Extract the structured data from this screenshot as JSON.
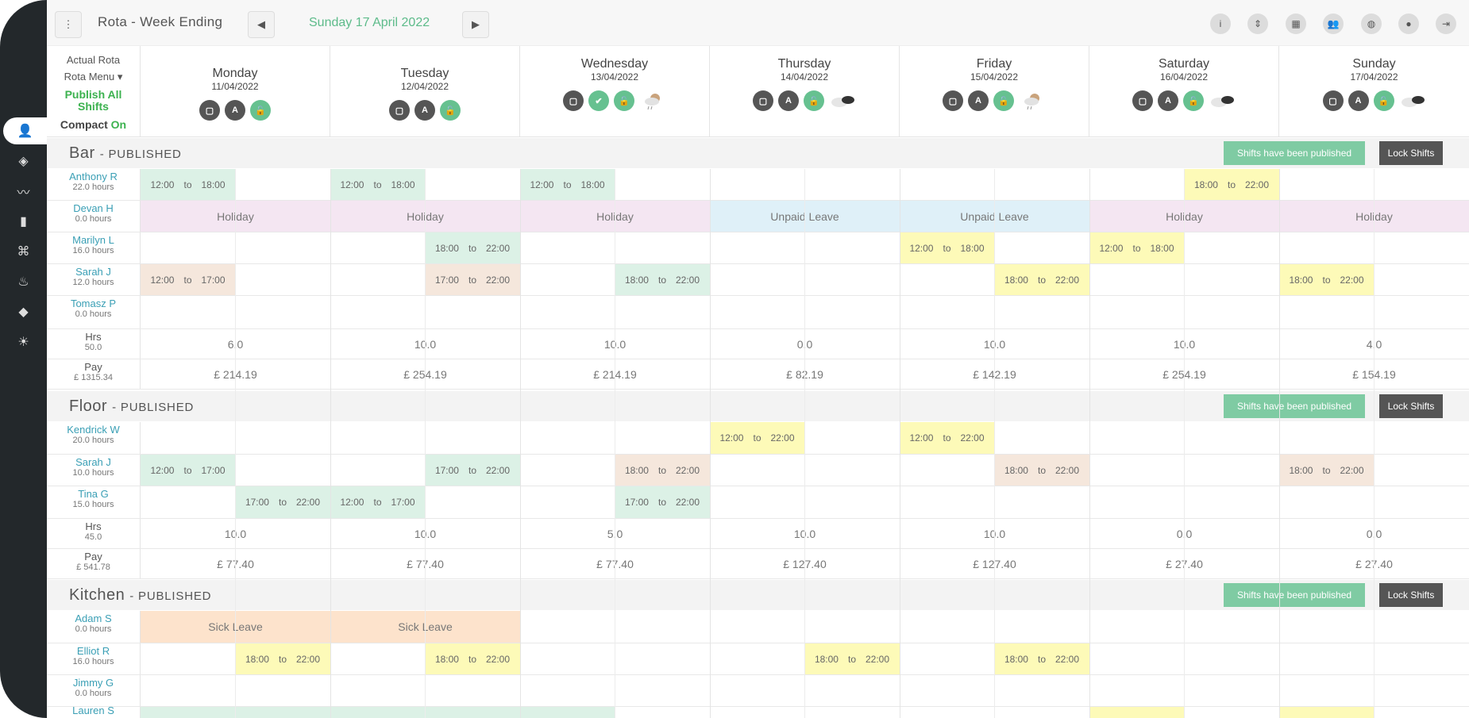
{
  "topbar": {
    "title": "Rota - Week Ending",
    "date": "Sunday 17 April 2022"
  },
  "left_header": {
    "actual_rota": "Actual Rota",
    "rota_menu": "Rota Menu ▾",
    "publish_all": "Publish All Shifts",
    "compact": "Compact",
    "compact_state": "On"
  },
  "days": [
    {
      "name": "Monday",
      "date": "11/04/2022"
    },
    {
      "name": "Tuesday",
      "date": "12/04/2022"
    },
    {
      "name": "Wednesday",
      "date": "13/04/2022"
    },
    {
      "name": "Thursday",
      "date": "14/04/2022"
    },
    {
      "name": "Friday",
      "date": "15/04/2022"
    },
    {
      "name": "Saturday",
      "date": "16/04/2022"
    },
    {
      "name": "Sunday",
      "date": "17/04/2022"
    }
  ],
  "shift_to": "to",
  "buttons": {
    "published": "Shifts have been published",
    "lock": "Lock Shifts"
  },
  "sections": [
    {
      "title": "Bar",
      "status": "- PUBLISHED",
      "staff": [
        {
          "name": "Anthony R",
          "hours": "22.0 hours"
        },
        {
          "name": "Devan H",
          "hours": "0.0 hours"
        },
        {
          "name": "Marilyn L",
          "hours": "16.0 hours"
        },
        {
          "name": "Sarah J",
          "hours": "12.0 hours"
        },
        {
          "name": "Tomasz P",
          "hours": "0.0 hours"
        }
      ],
      "hrs_label": "Hrs",
      "hrs_total": "50.0",
      "pay_label": "Pay",
      "pay_total": "£ 1315.34",
      "hrs": [
        "6.0",
        "10.0",
        "10.0",
        "0.0",
        "10.0",
        "10.0",
        "4.0"
      ],
      "pay": [
        "£ 214.19",
        "£ 254.19",
        "£ 214.19",
        "£ 82.19",
        "£ 142.19",
        "£ 254.19",
        "£ 154.19"
      ]
    },
    {
      "title": "Floor",
      "status": "- PUBLISHED",
      "staff": [
        {
          "name": "Kendrick W",
          "hours": "20.0 hours"
        },
        {
          "name": "Sarah J",
          "hours": "10.0 hours"
        },
        {
          "name": "Tina G",
          "hours": "15.0 hours"
        }
      ],
      "hrs_label": "Hrs",
      "hrs_total": "45.0",
      "pay_label": "Pay",
      "pay_total": "£ 541.78",
      "hrs": [
        "10.0",
        "10.0",
        "5.0",
        "10.0",
        "10.0",
        "0.0",
        "0.0"
      ],
      "pay": [
        "£ 77.40",
        "£ 77.40",
        "£ 77.40",
        "£ 127.40",
        "£ 127.40",
        "£ 27.40",
        "£ 27.40"
      ]
    },
    {
      "title": "Kitchen",
      "status": "- PUBLISHED",
      "staff": [
        {
          "name": "Adam S",
          "hours": "0.0 hours"
        },
        {
          "name": "Elliot R",
          "hours": "16.0 hours"
        },
        {
          "name": "Jimmy G",
          "hours": "0.0 hours"
        },
        {
          "name": "Lauren S",
          "hours": ""
        }
      ]
    }
  ],
  "shifts": {
    "t1200": "12:00",
    "t1800": "18:00",
    "t2200": "22:00",
    "t1700": "17:00"
  },
  "leave": {
    "holiday": "Holiday",
    "unpaid": "Unpaid Leave",
    "sick": "Sick Leave"
  }
}
